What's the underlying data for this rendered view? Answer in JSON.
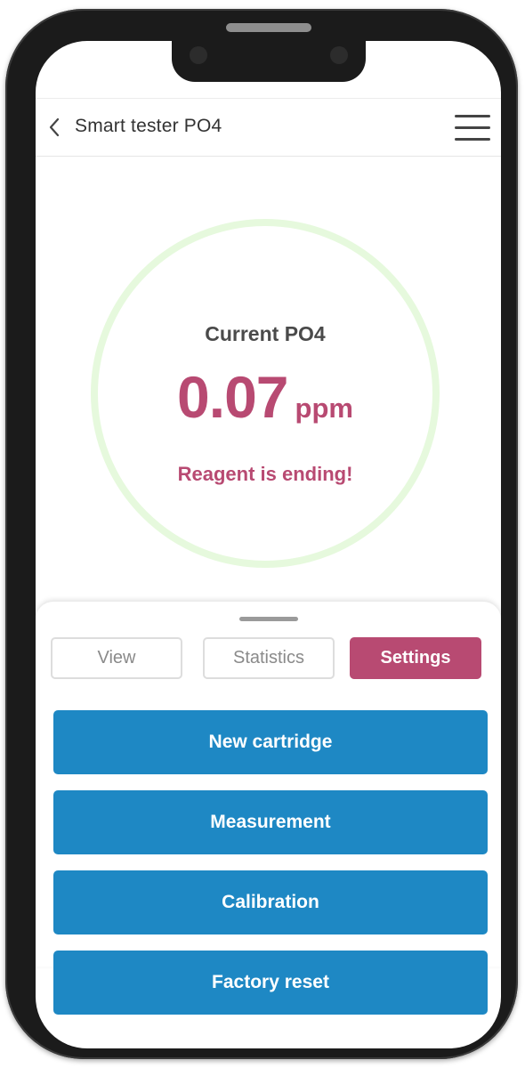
{
  "header": {
    "title": "Smart tester PO4"
  },
  "gauge": {
    "label": "Current PO4",
    "value": "0.07",
    "unit": "ppm",
    "warning": "Reagent is ending!"
  },
  "tabs": [
    {
      "label": "View",
      "active": false
    },
    {
      "label": "Statistics",
      "active": false
    },
    {
      "label": "Settings",
      "active": true
    }
  ],
  "actions": [
    {
      "label": "New cartridge"
    },
    {
      "label": "Measurement"
    },
    {
      "label": "Calibration"
    },
    {
      "label": "Factory reset"
    }
  ],
  "colors": {
    "accent": "#b84a72",
    "button_blue": "#1e88c4",
    "gauge_ring": "#e6f9dd"
  },
  "icons": {
    "back": "chevron-left-icon",
    "menu": "hamburger-menu-icon"
  }
}
